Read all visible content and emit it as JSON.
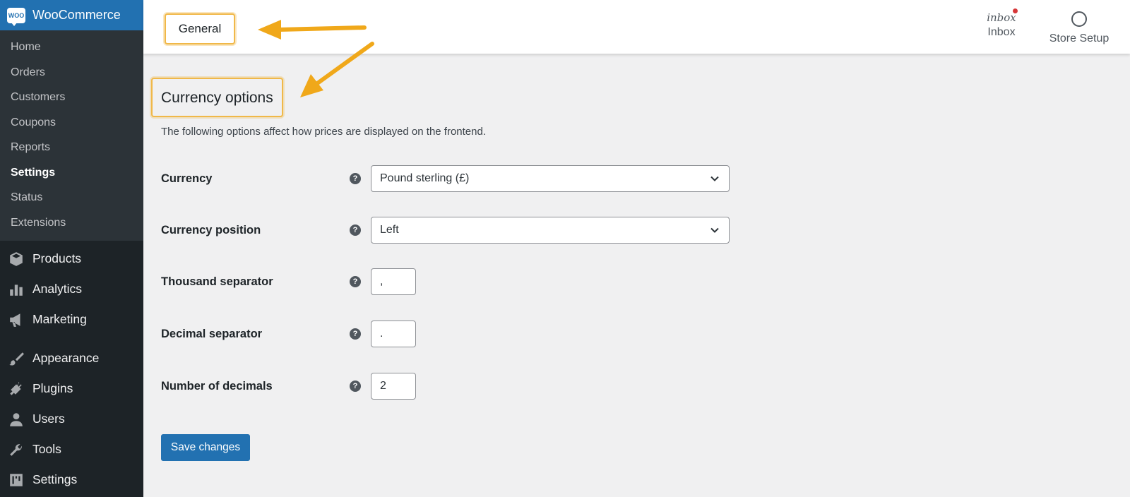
{
  "sidebar": {
    "brand": {
      "label": "WooCommerce",
      "logo_text": "WOO"
    },
    "submenu": [
      "Home",
      "Orders",
      "Customers",
      "Coupons",
      "Reports",
      "Settings",
      "Status",
      "Extensions"
    ],
    "active_submenu": "Settings",
    "menu": [
      "Products",
      "Analytics",
      "Marketing",
      "Appearance",
      "Plugins",
      "Users",
      "Tools",
      "Settings"
    ]
  },
  "header": {
    "title": "General",
    "inbox": {
      "icon_text": "inbox",
      "label": "Inbox"
    },
    "store_setup": {
      "label": "Store Setup"
    }
  },
  "section": {
    "title": "Currency options",
    "description": "The following options affect how prices are displayed on the frontend."
  },
  "fields": [
    {
      "label": "Currency",
      "type": "select",
      "value": "Pound sterling (£)"
    },
    {
      "label": "Currency position",
      "type": "select",
      "value": "Left"
    },
    {
      "label": "Thousand separator",
      "type": "input",
      "value": ","
    },
    {
      "label": "Decimal separator",
      "type": "input",
      "value": "."
    },
    {
      "label": "Number of decimals",
      "type": "input",
      "value": "2"
    }
  ],
  "help_glyph": "?",
  "save_label": "Save changes",
  "colors": {
    "sidebar_bg": "#1d2327",
    "submenu_bg": "#2c3338",
    "brand_blue": "#2271b1",
    "highlight": "#f0b849",
    "arrow": "#f0a81a",
    "notification_dot": "#d63638"
  }
}
